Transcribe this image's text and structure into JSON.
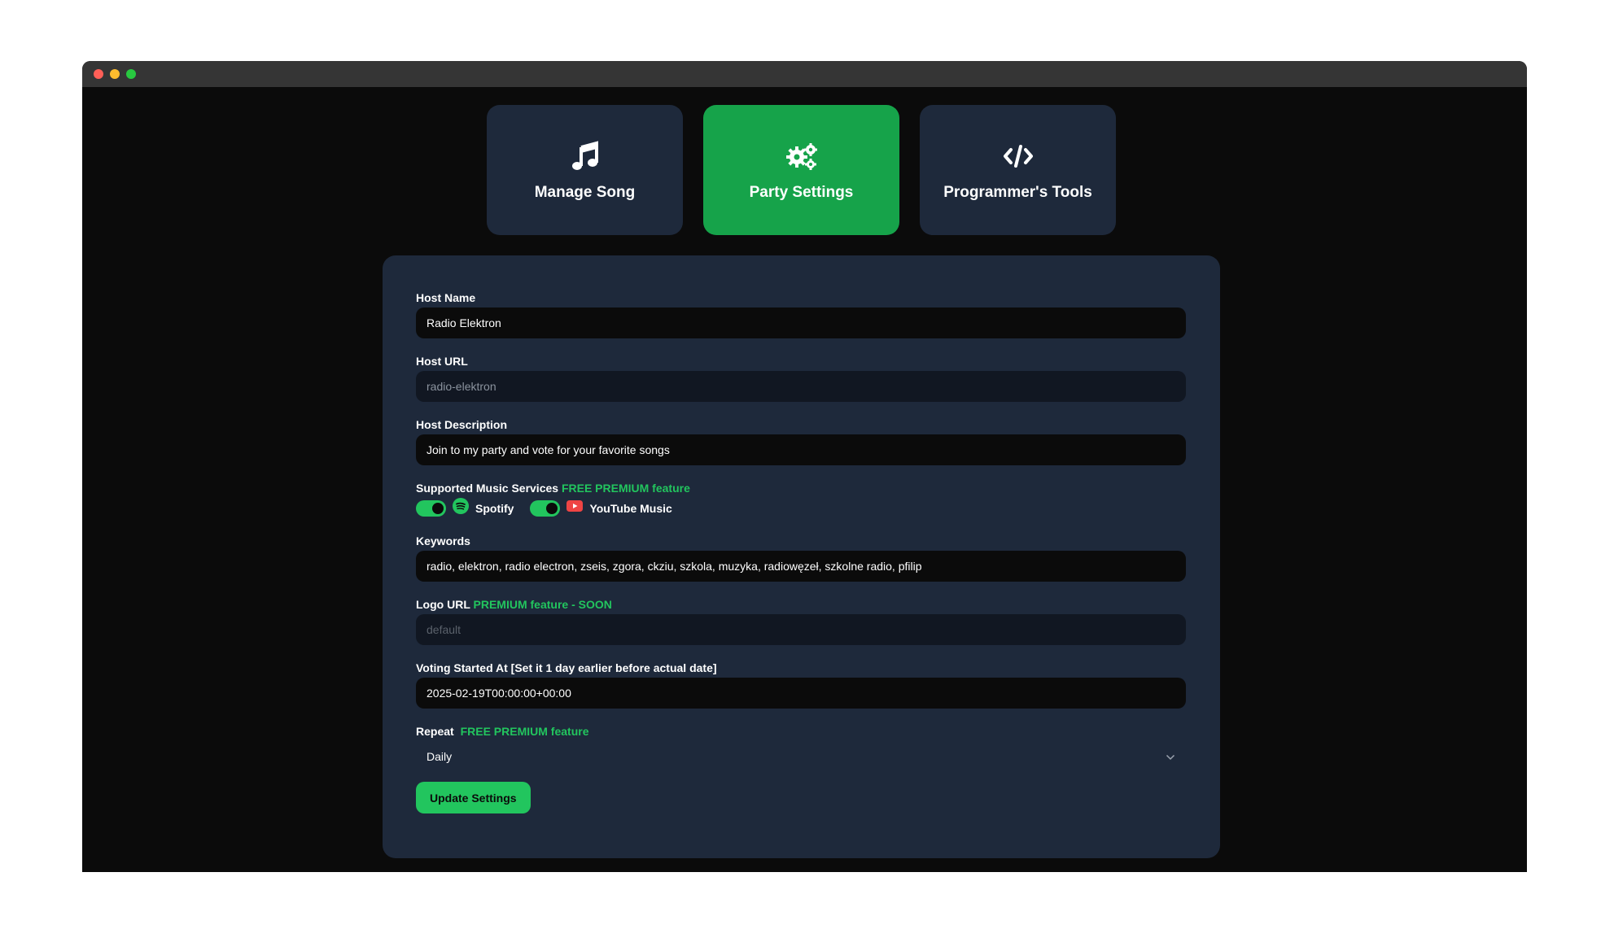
{
  "window": {
    "controls": [
      "close",
      "minimize",
      "maximize"
    ]
  },
  "tabs": [
    {
      "label": "Manage Song",
      "icon": "music-note-icon",
      "active": false
    },
    {
      "label": "Party Settings",
      "icon": "gears-icon",
      "active": true
    },
    {
      "label": "Programmer's Tools",
      "icon": "code-icon",
      "active": false
    }
  ],
  "form": {
    "host_name": {
      "label": "Host Name",
      "value": "Radio Elektron"
    },
    "host_url": {
      "label": "Host URL",
      "value": "radio-elektron"
    },
    "host_description": {
      "label": "Host Description",
      "value": "Join to my party and vote for your favorite songs"
    },
    "services": {
      "label": "Supported Music Services",
      "badge": "FREE PREMIUM feature",
      "items": [
        {
          "name": "Spotify",
          "enabled": true,
          "icon": "spotify-icon"
        },
        {
          "name": "YouTube Music",
          "enabled": true,
          "icon": "youtube-icon"
        }
      ]
    },
    "keywords": {
      "label": "Keywords",
      "value": "radio, elektron, radio electron, zseis, zgora, ckziu, szkola, muzyka, radiowęzeł, szkolne radio, pfilip"
    },
    "logo_url": {
      "label": "Logo URL",
      "badge": "PREMIUM feature - SOON",
      "placeholder": "default"
    },
    "voting_started": {
      "label": "Voting Started At [Set it 1 day earlier before actual date]",
      "value": "2025-02-19T00:00:00+00:00"
    },
    "repeat": {
      "label": "Repeat",
      "badge": "FREE PREMIUM feature",
      "value": "Daily"
    },
    "submit_label": "Update Settings"
  },
  "colors": {
    "accent": "#22c55e",
    "active_tab": "#16a34a",
    "panel": "#1e293b",
    "background": "#0b0b0b"
  }
}
